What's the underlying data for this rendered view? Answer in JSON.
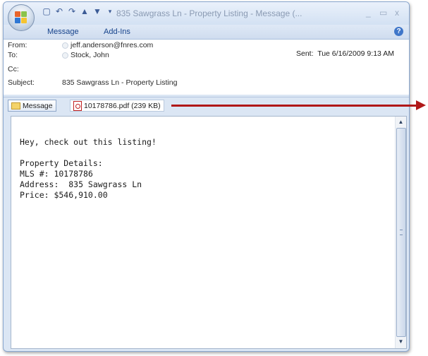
{
  "window": {
    "title": "835 Sawgrass Ln - Property Listing - Message (...",
    "minimize_glyph": "_",
    "maximize_glyph": "▭",
    "close_glyph": "x"
  },
  "ribbon": {
    "tabs": [
      {
        "label": "Message"
      },
      {
        "label": "Add-Ins"
      }
    ],
    "help_glyph": "?"
  },
  "header": {
    "from_label": "From:",
    "from_value": "jeff.anderson@fnres.com",
    "to_label": "To:",
    "to_value": "Stock, John",
    "cc_label": "Cc:",
    "cc_value": "",
    "subject_label": "Subject:",
    "subject_value": "835 Sawgrass Ln - Property Listing",
    "sent_label": "Sent:",
    "sent_value": "Tue 6/16/2009 9:13 AM"
  },
  "attachments": {
    "message_tab_label": "Message",
    "file_label": "10178786.pdf (239 KB)"
  },
  "body": {
    "lines": [
      "Hey, check out this listing!",
      "",
      "Property Details:",
      "MLS #: 10178786",
      "Address:  835 Sawgrass Ln",
      "Price: $546,910.00"
    ]
  },
  "colors": {
    "annotation_arrow": "#b01818",
    "ribbon_text": "#15428b",
    "window_frame": "#8aa7cf"
  }
}
